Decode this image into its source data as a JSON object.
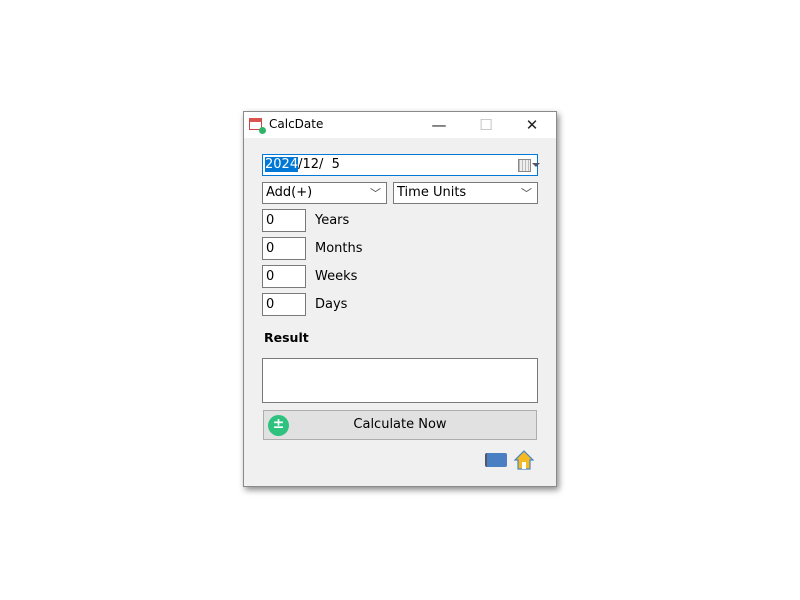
{
  "window": {
    "title": "CalcDate",
    "minimize": "—",
    "maximize": "☐",
    "close": "✕"
  },
  "date": {
    "year": "2024",
    "rest": "/12/  5"
  },
  "operation": {
    "value": "Add(+)"
  },
  "units": {
    "value": "Time Units"
  },
  "fields": [
    {
      "value": "0",
      "label": "Years"
    },
    {
      "value": "0",
      "label": "Months"
    },
    {
      "value": "0",
      "label": "Weeks"
    },
    {
      "value": "0",
      "label": "Days"
    }
  ],
  "result": {
    "label": "Result",
    "value": ""
  },
  "calculate": {
    "label": "Calculate Now",
    "icon": "plus-minus-icon"
  },
  "footer": {
    "icons": [
      "flag-icon",
      "home-icon"
    ]
  }
}
